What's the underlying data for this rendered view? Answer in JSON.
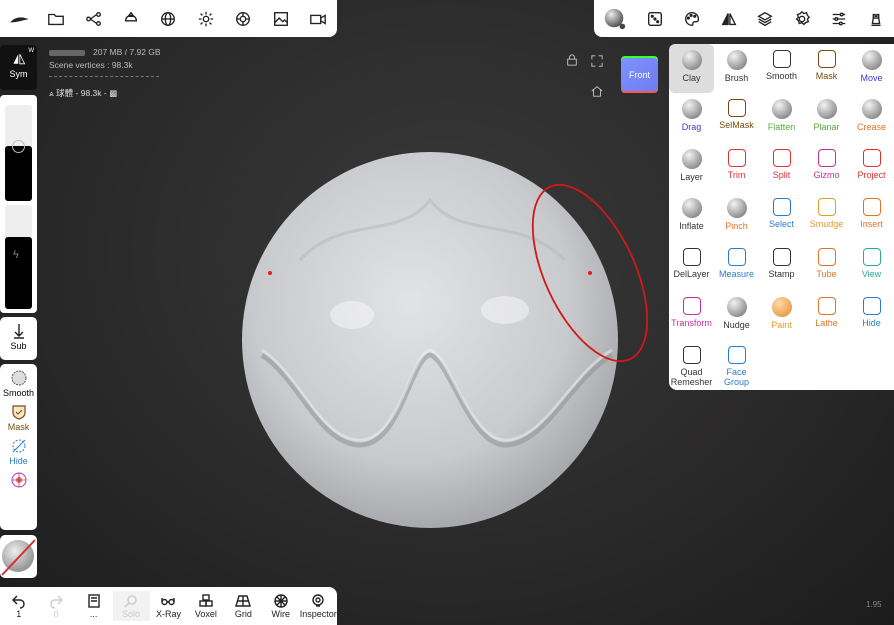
{
  "top_left_icons": [
    "brush-stroke-icon",
    "folder-icon",
    "scene-graph-icon",
    "layer-cut-icon",
    "globe-icon",
    "light-icon",
    "material-icon",
    "image-icon",
    "camera-icon"
  ],
  "top_right_icons": [
    "sphere-icon",
    "dice-icon",
    "palette-icon",
    "symmetry-icon",
    "layers-icon",
    "gear-icon",
    "sliders-icon",
    "chess-icon"
  ],
  "info": {
    "memory": "207 MB / 7.92 GB",
    "vertices": "Scene vertices : 98.3k",
    "object": "球體 - 98.3k - "
  },
  "left": {
    "sym_label": "Sym",
    "sym_sup": "W",
    "sub_label": "Sub",
    "smooth_label": "Smooth",
    "mask_label": "Mask",
    "hide_label": "Hide"
  },
  "viewcube": {
    "label": "Front"
  },
  "bottom": [
    {
      "label": "1",
      "icon": "undo-icon"
    },
    {
      "label": "0",
      "icon": "redo-icon"
    },
    {
      "label": "...",
      "icon": "notebook-icon"
    },
    {
      "label": "Solo",
      "icon": "search-icon"
    },
    {
      "label": "X-Ray",
      "icon": "glasses-icon"
    },
    {
      "label": "Voxel",
      "icon": "voxel-icon"
    },
    {
      "label": "Grid",
      "icon": "grid-icon"
    },
    {
      "label": "Wire",
      "icon": "wire-icon"
    },
    {
      "label": "Inspector",
      "icon": "inspector-icon"
    }
  ],
  "fps": "1.95",
  "tools": [
    {
      "label": "Clay",
      "color": "#333333",
      "icon": "clay-sphere-icon"
    },
    {
      "label": "Brush",
      "color": "#333333",
      "icon": "brush-sphere-icon"
    },
    {
      "label": "Smooth",
      "color": "#333333",
      "icon": "smooth-icon"
    },
    {
      "label": "Mask",
      "color": "#7a4a10",
      "icon": "mask-icon"
    },
    {
      "label": "Move",
      "color": "#3a3ad0",
      "icon": "move-sphere-icon"
    },
    {
      "label": "Drag",
      "color": "#3a3ad0",
      "icon": "drag-sphere-icon"
    },
    {
      "label": "SelMask",
      "color": "#7a4a10",
      "icon": "selmask-icon"
    },
    {
      "label": "Flatten",
      "color": "#5aa83a",
      "icon": "flatten-sphere-icon"
    },
    {
      "label": "Planar",
      "color": "#5aa83a",
      "icon": "planar-sphere-icon"
    },
    {
      "label": "Crease",
      "color": "#e0722a",
      "icon": "crease-sphere-icon"
    },
    {
      "label": "Layer",
      "color": "#333333",
      "icon": "layer-sphere-icon"
    },
    {
      "label": "Trim",
      "color": "#e03030",
      "icon": "trim-icon"
    },
    {
      "label": "Split",
      "color": "#e03030",
      "icon": "split-icon"
    },
    {
      "label": "Gizmo",
      "color": "#c030a0",
      "icon": "gizmo-icon"
    },
    {
      "label": "Project",
      "color": "#e03030",
      "icon": "project-icon"
    },
    {
      "label": "Inflate",
      "color": "#333333",
      "icon": "inflate-sphere-icon"
    },
    {
      "label": "Pinch",
      "color": "#e0722a",
      "icon": "pinch-sphere-icon"
    },
    {
      "label": "Select",
      "color": "#2a7ad0",
      "icon": "select-icon"
    },
    {
      "label": "Smudge",
      "color": "#e09a2a",
      "icon": "smudge-icon"
    },
    {
      "label": "Insert",
      "color": "#e0722a",
      "icon": "insert-icon"
    },
    {
      "label": "DelLayer",
      "color": "#333333",
      "icon": "dellayer-icon"
    },
    {
      "label": "Measure",
      "color": "#2a7ad0",
      "icon": "measure-icon"
    },
    {
      "label": "Stamp",
      "color": "#333333",
      "icon": "stamp-icon"
    },
    {
      "label": "Tube",
      "color": "#e0722a",
      "icon": "tube-icon"
    },
    {
      "label": "View",
      "color": "#2aa8a0",
      "icon": "view-camera-icon"
    },
    {
      "label": "Transform",
      "color": "#c030a0",
      "icon": "transform-icon"
    },
    {
      "label": "Nudge",
      "color": "#333333",
      "icon": "nudge-sphere-icon"
    },
    {
      "label": "Paint",
      "color": "#e09a2a",
      "icon": "paint-sphere-icon"
    },
    {
      "label": "Lathe",
      "color": "#e0722a",
      "icon": "lathe-icon"
    },
    {
      "label": "Hide",
      "color": "#2a7ad0",
      "icon": "hide-icon"
    },
    {
      "label": "Quad\nRemesher",
      "color": "#333333",
      "icon": "quad-remesher-icon"
    },
    {
      "label": "Face Group",
      "color": "#2a7ad0",
      "icon": "face-group-icon"
    }
  ]
}
